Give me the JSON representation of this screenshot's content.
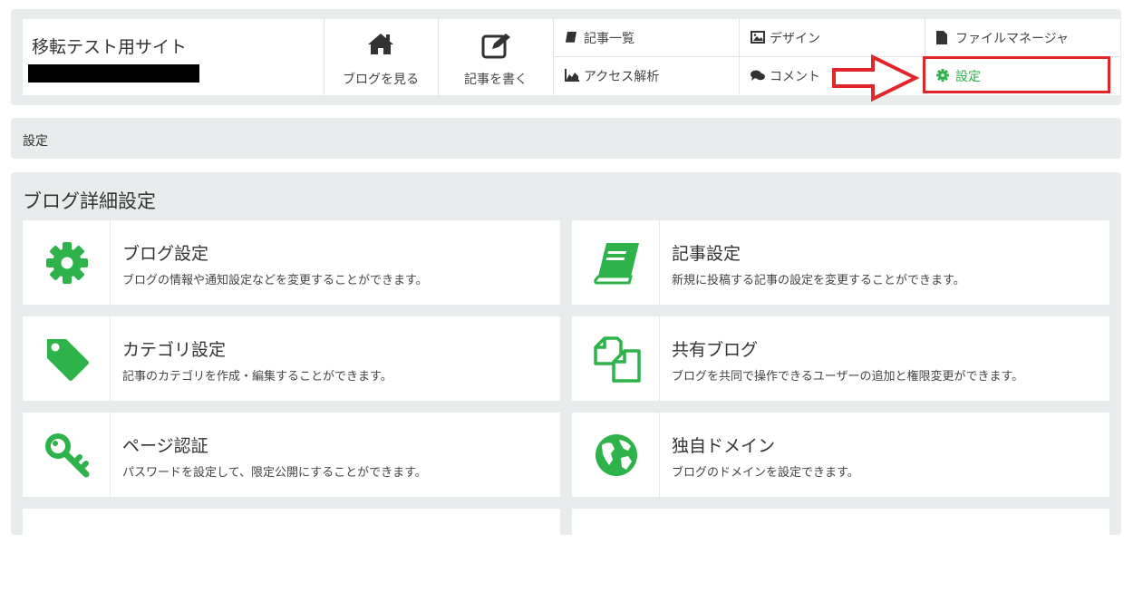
{
  "header": {
    "site_title": "移転テスト用サイト",
    "nav_big": [
      {
        "label": "ブログを見る",
        "icon": "home-icon"
      },
      {
        "label": "記事を書く",
        "icon": "edit-icon"
      }
    ],
    "nav_small": [
      {
        "label": "記事一覧",
        "icon": "book-icon"
      },
      {
        "label": "デザイン",
        "icon": "image-icon"
      },
      {
        "label": "ファイルマネージャ",
        "icon": "file-icon"
      },
      {
        "label": "アクセス解析",
        "icon": "area-chart-icon"
      },
      {
        "label": "コメント",
        "icon": "comments-icon"
      },
      {
        "label": "設定",
        "icon": "gear-icon",
        "active": true
      }
    ]
  },
  "breadcrumb": {
    "current": "設定"
  },
  "detail": {
    "title": "ブログ詳細設定",
    "cards": [
      {
        "title": "ブログ設定",
        "desc": "ブログの情報や通知設定などを変更することができます。",
        "icon": "gear-icon"
      },
      {
        "title": "記事設定",
        "desc": "新規に投稿する記事の設定を変更することができます。",
        "icon": "book-icon"
      },
      {
        "title": "カテゴリ設定",
        "desc": "記事のカテゴリを作成・編集することができます。",
        "icon": "tag-icon"
      },
      {
        "title": "共有ブログ",
        "desc": "ブログを共同で操作できるユーザーの追加と権限変更ができます。",
        "icon": "files-icon"
      },
      {
        "title": "ページ認証",
        "desc": "パスワードを設定して、限定公開にすることができます。",
        "icon": "key-icon"
      },
      {
        "title": "独自ドメイン",
        "desc": "ブログのドメインを設定できます。",
        "icon": "globe-icon"
      }
    ]
  },
  "colors": {
    "accent": "#2db34a",
    "highlight": "#e0262a",
    "panel": "#e9ecec"
  }
}
